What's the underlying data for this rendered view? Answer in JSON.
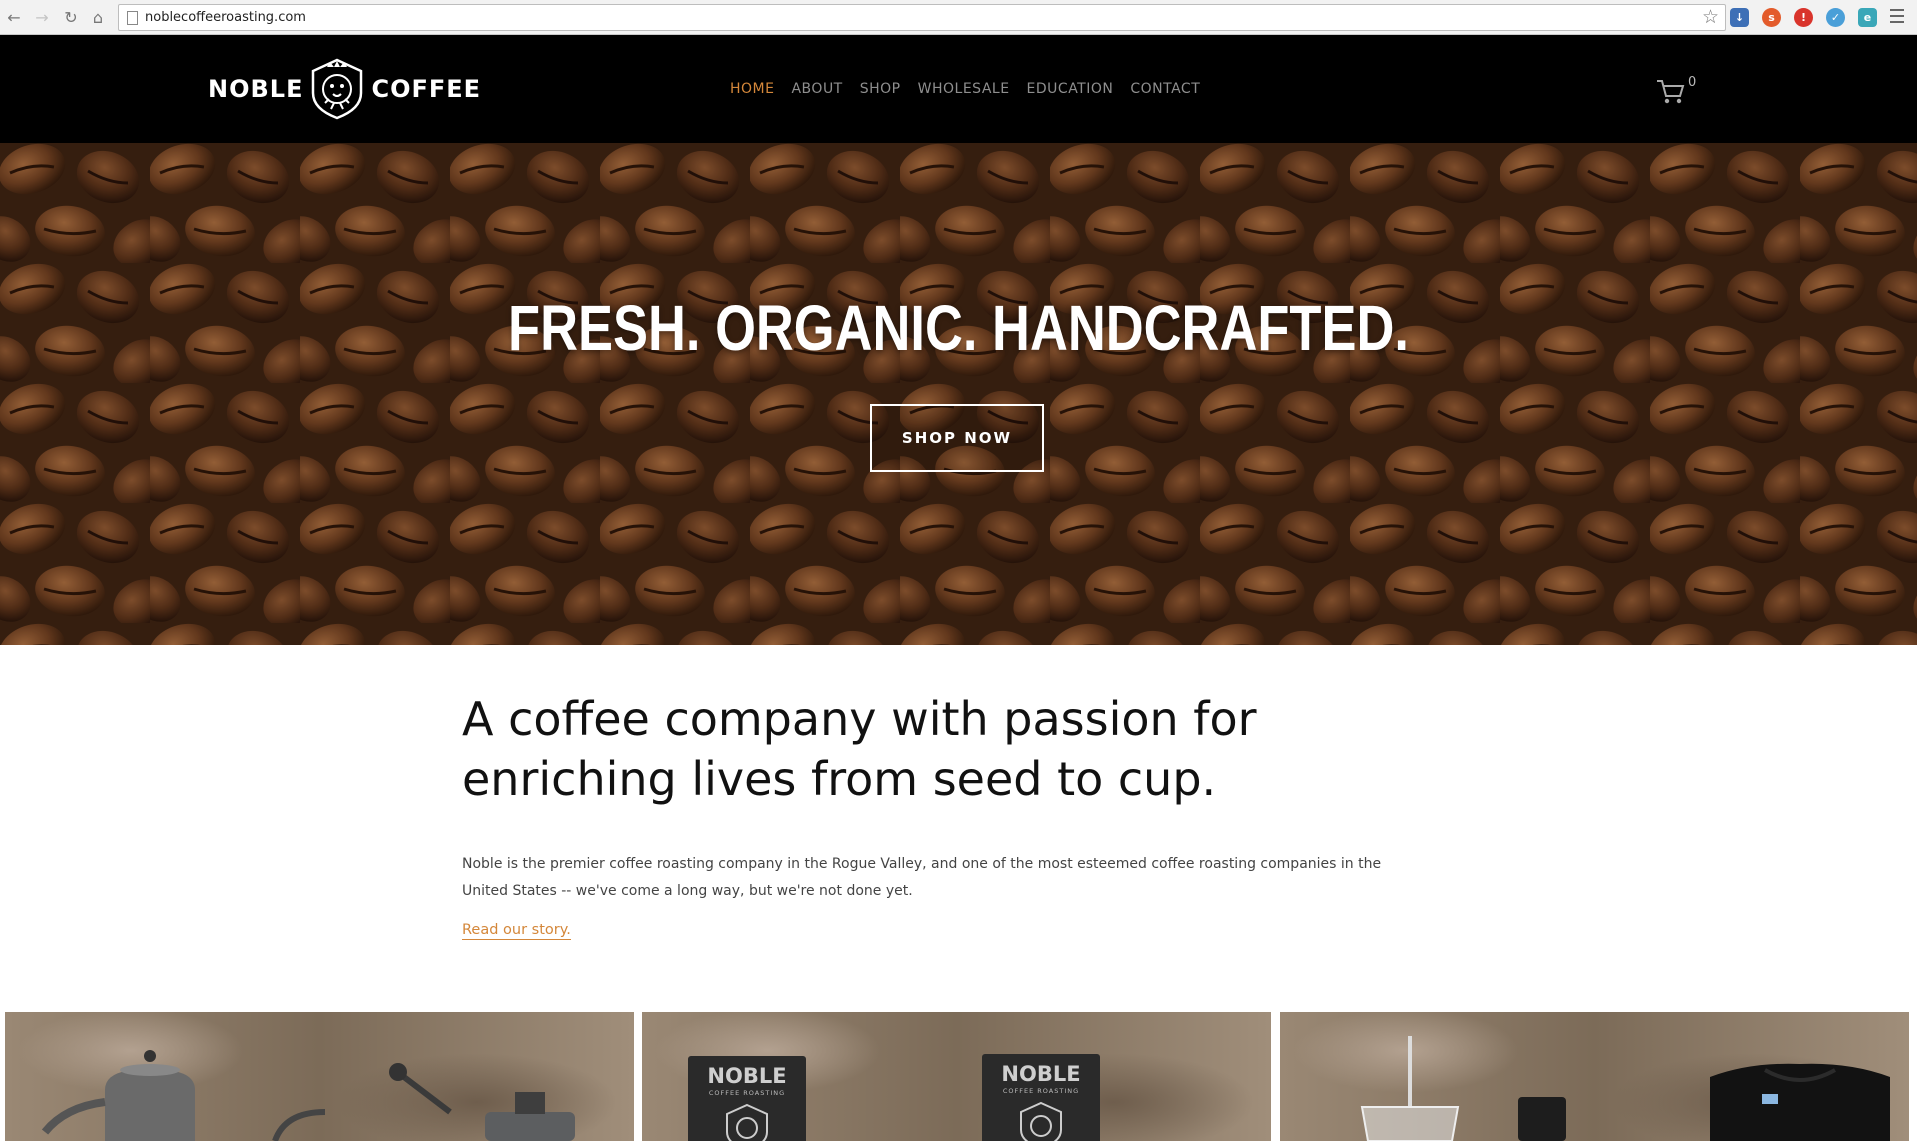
{
  "browser": {
    "url": "noblecoffeeroasting.com"
  },
  "header": {
    "logo_left": "NOBLE",
    "logo_right": "COFFEE",
    "nav": [
      {
        "label": "HOME",
        "active": true
      },
      {
        "label": "ABOUT",
        "active": false
      },
      {
        "label": "SHOP",
        "active": false
      },
      {
        "label": "WHOLESALE",
        "active": false
      },
      {
        "label": "EDUCATION",
        "active": false
      },
      {
        "label": "CONTACT",
        "active": false
      }
    ],
    "cart_count": "0"
  },
  "hero": {
    "title": "FRESH. ORGANIC. HANDCRAFTED.",
    "button": "SHOP NOW"
  },
  "intro": {
    "heading_line1": "A coffee company with passion for",
    "heading_line2": "enriching lives from seed to cup.",
    "body_line1": "Noble is the premier coffee roasting company in the Rogue Valley, and one of the most esteemed coffee roasting companies in the",
    "body_line2": "United States -- we've come a long way, but we're not done yet.",
    "link": "Read our story."
  },
  "tiles": {
    "bag_brand": "NOBLE",
    "bag_sub": "COFFEE ROASTING"
  },
  "colors": {
    "accent": "#d4873a",
    "header_bg": "#000000",
    "nav_inactive": "#8e8e8e"
  },
  "icons": {
    "back": "arrow-left-icon",
    "forward": "arrow-right-icon",
    "reload": "reload-icon",
    "home": "home-icon",
    "bookmark": "star-icon",
    "cart": "cart-icon",
    "menu": "hamburger-icon"
  }
}
